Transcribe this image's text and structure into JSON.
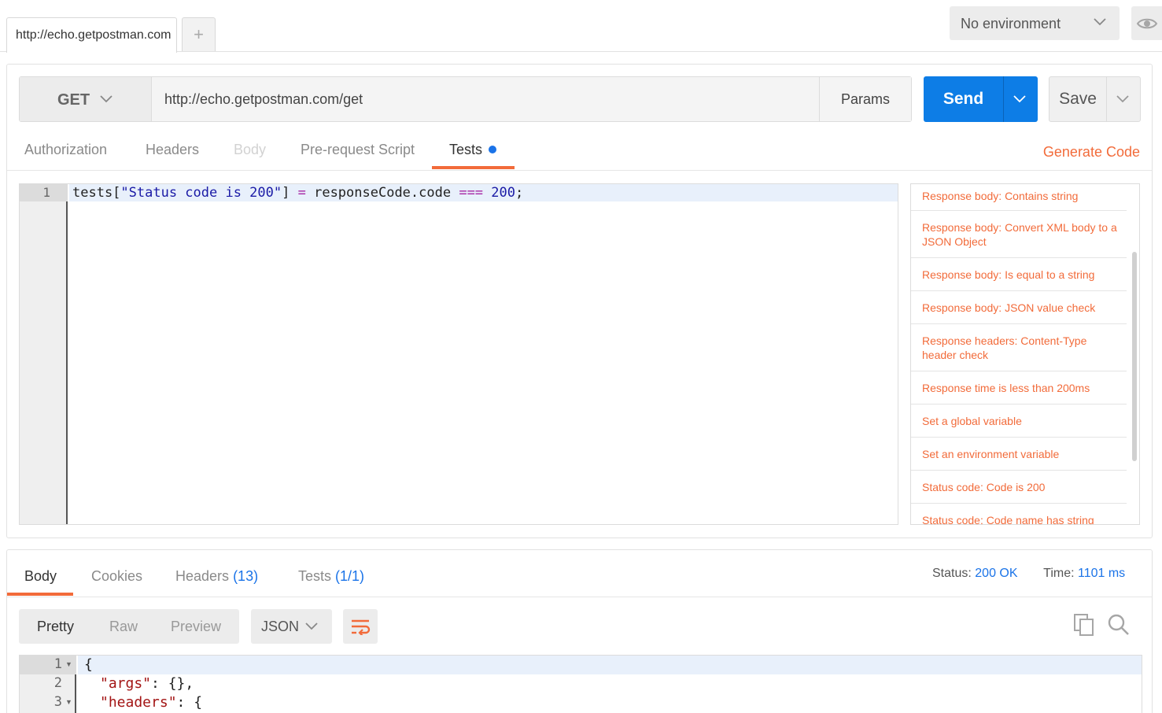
{
  "tabs": [
    {
      "label": "http://echo.getpostman.com"
    }
  ],
  "environment": {
    "selected": "No environment"
  },
  "request": {
    "method": "GET",
    "url": "http://echo.getpostman.com/get",
    "params_label": "Params",
    "send_label": "Send",
    "save_label": "Save",
    "tabs": [
      {
        "label": "Authorization"
      },
      {
        "label": "Headers"
      },
      {
        "label": "Body"
      },
      {
        "label": "Pre-request Script"
      },
      {
        "label": "Tests"
      }
    ],
    "active_tab": "Tests",
    "generate_code_label": "Generate Code"
  },
  "tests_editor": {
    "line_number": "1",
    "code": {
      "part1": "tests[",
      "part2": "\"Status code is 200\"",
      "part3": "] ",
      "part4": "=",
      "part5": " responseCode.code ",
      "part6": "===",
      "part7": " ",
      "part8": "200",
      "part9": ";"
    }
  },
  "snippets": [
    "Response body: Contains string",
    "Response body: Convert XML body to a JSON Object",
    "Response body: Is equal to a string",
    "Response body: JSON value check",
    "Response headers: Content-Type header check",
    "Response time is less than 200ms",
    "Set a global variable",
    "Set an environment variable",
    "Status code: Code is 200",
    "Status code: Code name has string"
  ],
  "response": {
    "tabs": {
      "body": "Body",
      "cookies": "Cookies",
      "headers": "Headers",
      "headers_count": "(13)",
      "tests": "Tests",
      "tests_count": "(1/1)"
    },
    "status_label": "Status:",
    "status_value": "200 OK",
    "time_label": "Time:",
    "time_value": "1101 ms",
    "views": {
      "pretty": "Pretty",
      "raw": "Raw",
      "preview": "Preview"
    },
    "format": "JSON",
    "lines": [
      {
        "num": "1",
        "text": "{"
      },
      {
        "num": "2",
        "key": "\"args\"",
        "rest": ": {},"
      },
      {
        "num": "3",
        "key": "\"headers\"",
        "rest": ": {"
      }
    ]
  },
  "colors": {
    "accent": "#f26b3a",
    "send": "#0d7de6",
    "link": "#1a73e8"
  }
}
